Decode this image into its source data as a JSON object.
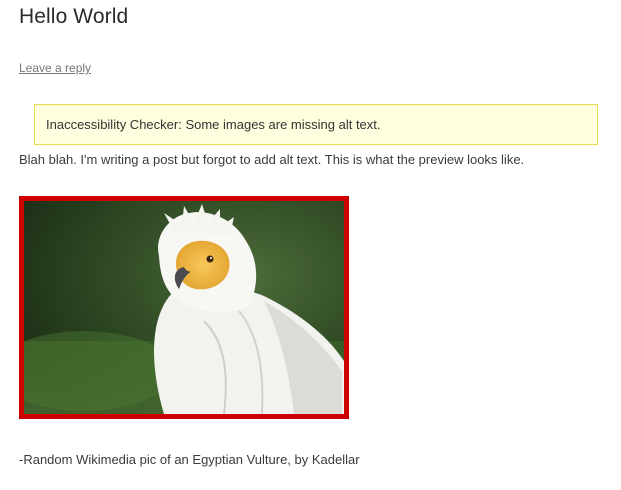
{
  "post": {
    "title": "Hello World",
    "reply_link": "Leave a reply",
    "body": "Blah blah. I'm writing a post but forgot to add alt text. This is what the preview looks like.",
    "caption": "-Random Wikimedia pic of an Egyptian Vulture, by Kadellar"
  },
  "notice": {
    "text": "Inaccessibility Checker: Some images are missing alt text."
  },
  "image": {
    "subject": "egyptian-vulture-photo",
    "highlight_color": "#cc0000"
  }
}
